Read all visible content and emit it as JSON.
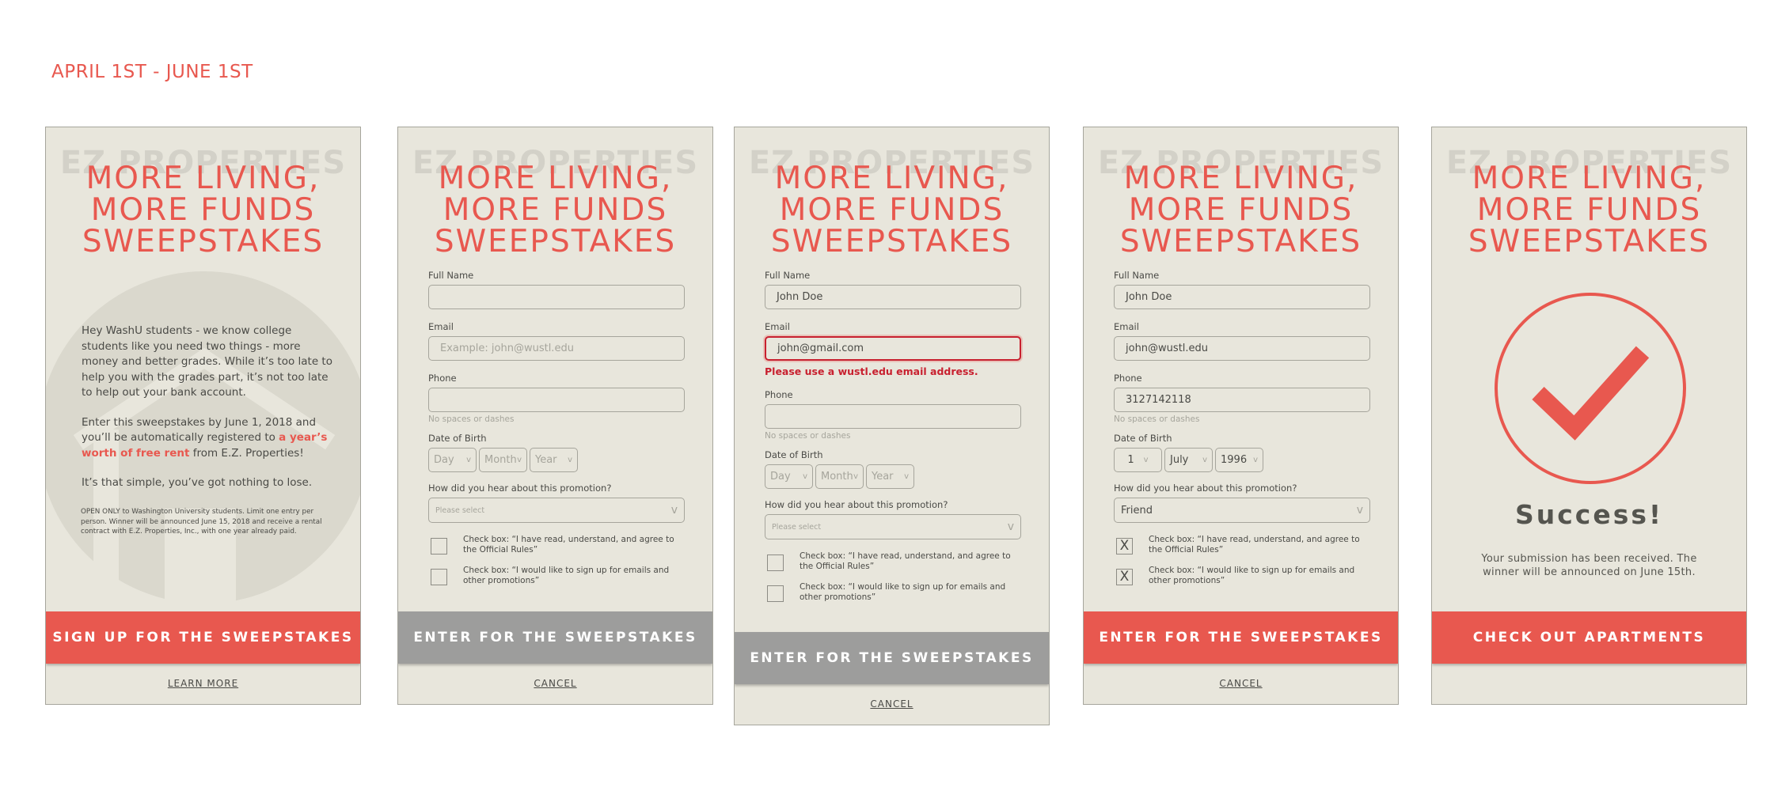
{
  "date_range": "APRIL 1ST - JUNE 1ST",
  "brand_watermark": "EZ PROPERTIES",
  "headline": [
    "MORE LIVING,",
    "MORE FUNDS",
    "SWEEPSTAKES"
  ],
  "colors": {
    "accent": "#e8584f",
    "panel_bg": "#e8e6dc",
    "button_gray": "#9d9d9c",
    "error": "#c8202f"
  },
  "intro": {
    "p1": "Hey WashU students - we know college students like you need two things - more money and better grades. While it’s too late to help you with the grades part, it’s not too late to help out your bank account.",
    "p2_before": "Enter this sweepstakes by June 1, 2018 and you’ll be automatically registered to ",
    "p2_highlight": "a year’s worth of free rent",
    "p2_after": " from E.Z. Properties!",
    "p3": "It’s that simple, you’ve got nothing to lose.",
    "fine_print": "OPEN ONLY to Washington University students. Limit one entry  per person. Winner will be announced June 15, 2018 and receive a rental contract with E.Z. Properties, Inc., with one year already paid.",
    "cta": "SIGN UP FOR THE SWEEPSTAKES",
    "secondary": "LEARN MORE"
  },
  "form_labels": {
    "full_name": "Full Name",
    "email": "Email",
    "phone": "Phone",
    "phone_hint": "No spaces or dashes",
    "dob": "Date of Birth",
    "how_hear": "How did you hear about this promotion?",
    "check1": "Check box: “I have read, understand, and agree to the Official Rules”",
    "check2": "Check box: “I would like to sign up for emails and other promotions”",
    "cta": "ENTER FOR THE SWEEPSTAKES",
    "cancel": "CANCEL"
  },
  "empty_form": {
    "email_placeholder": "Example: john@wustl.edu",
    "day": "Day",
    "month": "Month",
    "year": "Year",
    "select_placeholder": "Please select",
    "chevron": "v"
  },
  "error_form": {
    "full_name": "John Doe",
    "email": "john@gmail.com",
    "error": "Please use a wustl.edu email address."
  },
  "filled_form": {
    "full_name": "John Doe",
    "email": "john@wustl.edu",
    "phone": "3127142118",
    "day": "1",
    "month": "July",
    "year": "1996",
    "how_hear": "Friend",
    "check_mark": "X"
  },
  "success": {
    "title": "Success!",
    "message": "Your submission has been received. The winner will be announced on June 15th.",
    "cta": "CHECK OUT APARTMENTS"
  }
}
